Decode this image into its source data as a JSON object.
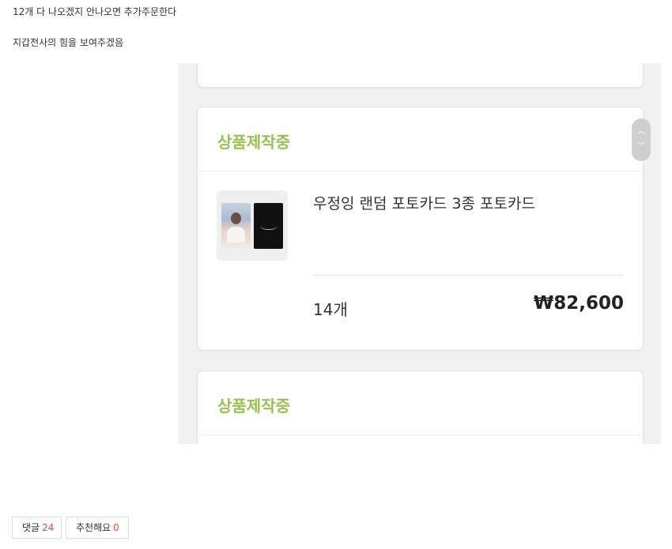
{
  "post": {
    "line1": "12개 다 나오겠지 안나오면 추가주문한다",
    "line2": "지갑전사의 힘을 보여주겠음"
  },
  "order": {
    "status_label": "상품제작중",
    "product_name": "우정잉 랜덤 포토카드 3종 포토카드",
    "quantity": "14개",
    "price": "₩82,600",
    "next_status_label": "상품제작중"
  },
  "actions": {
    "comment_label": "댓글",
    "comment_count": "24",
    "recommend_label": "추천해요",
    "recommend_count": "0"
  },
  "colors": {
    "status_green": "#95c34d",
    "count_red": "#e04b2c"
  }
}
